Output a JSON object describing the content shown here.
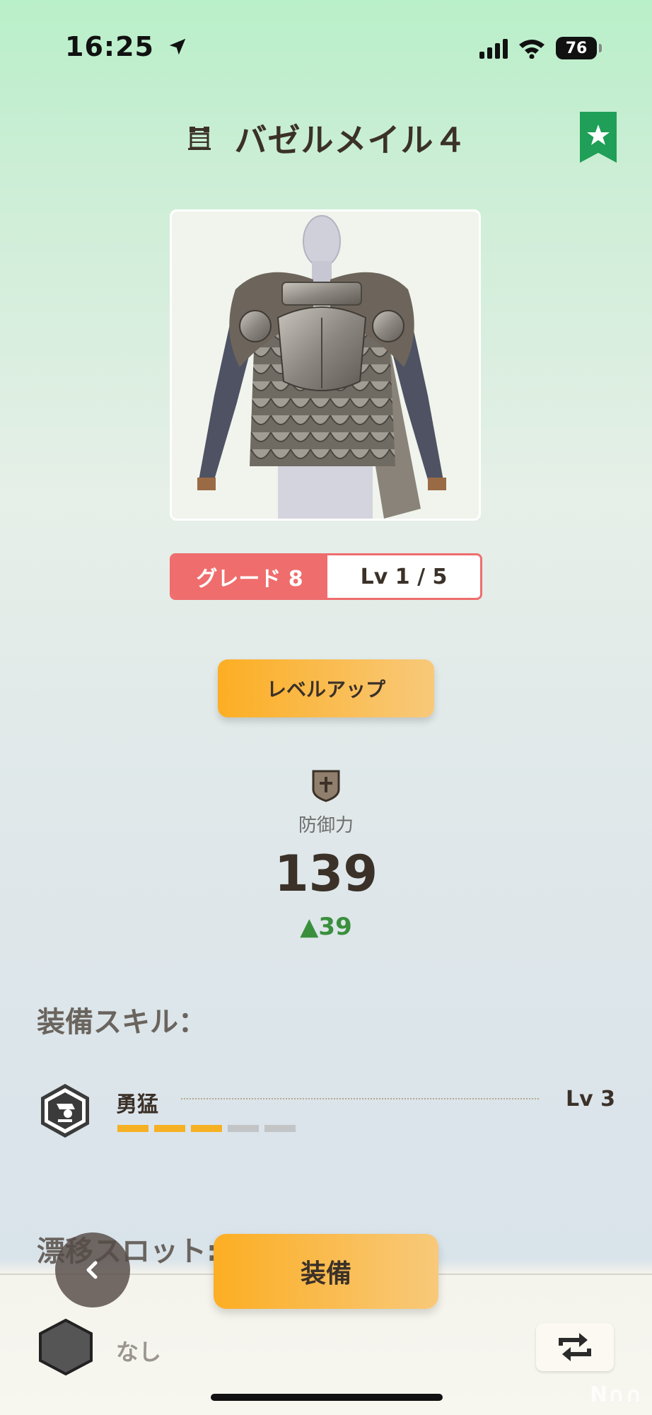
{
  "status_bar": {
    "time": "16:25",
    "battery": "76",
    "icons": [
      "location-arrow-icon",
      "signal-bars-icon",
      "wifi-icon",
      "battery-icon"
    ]
  },
  "header": {
    "title": "バゼルメイル４",
    "type_icon": "armor-icon",
    "bookmark_icon": "star-bookmark-icon",
    "bookmark_color": "#1f9f57"
  },
  "item": {
    "image_icon": "armor-preview-image",
    "grade_label": "グレード 8",
    "level_label": "Lv 1 / 5",
    "grade_color": "#ef6d6d"
  },
  "actions": {
    "level_up_label": "レベルアップ",
    "equip_label": "装備"
  },
  "stats": {
    "defense_icon": "shield-icon",
    "defense_label": "防御力",
    "defense_value": "139",
    "defense_delta": "▲39",
    "delta_color": "#3a8f3c"
  },
  "equip_skills": {
    "title": "装備スキル：",
    "skills": [
      {
        "name": "勇猛",
        "level": "Lv 3",
        "icon": "skill-hexagon-icon",
        "filled": 3,
        "total": 5
      }
    ]
  },
  "drift_slot": {
    "title": "漂移スロット:",
    "empty_label": "なし",
    "slot_icon": "empty-hexagon-icon"
  },
  "bottom_bar": {
    "back_icon": "chevron-left-icon",
    "swap_icon": "swap-arrows-icon"
  },
  "watermark": "N∩∩",
  "accent_colors": {
    "button_orange": "#fcae23",
    "skill_bar_filled": "#f6b023",
    "skill_bar_empty": "#c2c4c6"
  }
}
